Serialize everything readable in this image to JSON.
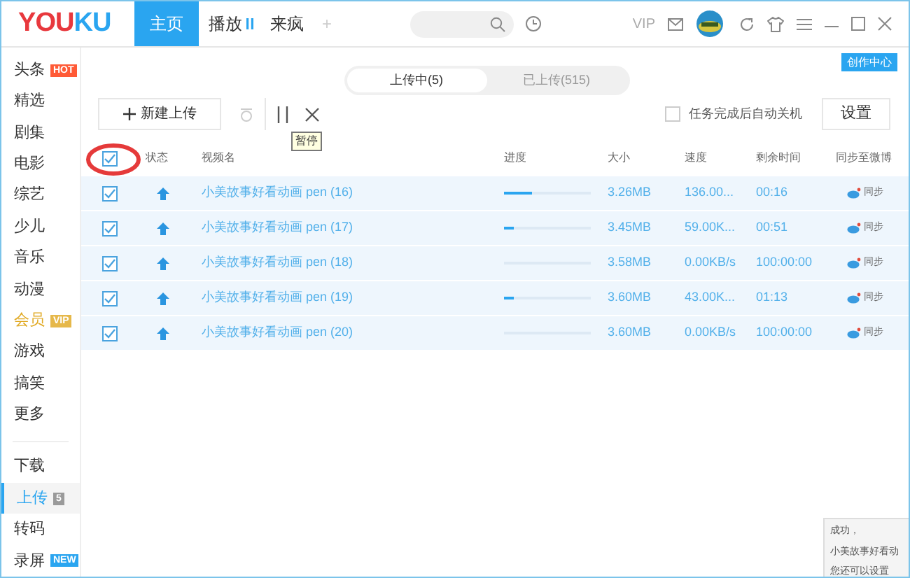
{
  "logo": {
    "left": "YOU",
    "right": "KU"
  },
  "nav_tabs": [
    {
      "label": "主页",
      "selected": true,
      "kind": "text"
    },
    {
      "label": "播放",
      "selected": false,
      "kind": "playing"
    },
    {
      "label": "来疯",
      "selected": false,
      "kind": "text"
    },
    {
      "label": "+",
      "selected": false,
      "kind": "add"
    }
  ],
  "top_right": {
    "vip": "VIP"
  },
  "sidebar": {
    "items": [
      {
        "label": "头条",
        "badge": {
          "text": "HOT",
          "color": "#ff5a36"
        },
        "selected": false
      },
      {
        "label": "精选",
        "selected": false
      },
      {
        "label": "剧集",
        "selected": false
      },
      {
        "label": "电影",
        "selected": false
      },
      {
        "label": "综艺",
        "selected": false
      },
      {
        "label": "少儿",
        "selected": false
      },
      {
        "label": "音乐",
        "selected": false
      },
      {
        "label": "动漫",
        "selected": false
      },
      {
        "label": "会员",
        "badge": {
          "text": "VIP",
          "color": "#e6b84a"
        },
        "selected": false,
        "gold": true
      },
      {
        "label": "游戏",
        "selected": false
      },
      {
        "label": "搞笑",
        "selected": false
      },
      {
        "label": "更多",
        "selected": false
      }
    ],
    "tools": [
      {
        "label": "下载",
        "selected": false
      },
      {
        "label": "上传",
        "badge": {
          "text": "5",
          "color": "#9a9a9a"
        },
        "selected": true
      },
      {
        "label": "转码",
        "selected": false
      },
      {
        "label": "录屏",
        "badge": {
          "text": "NEW",
          "color": "#2aa5f0"
        },
        "selected": false
      }
    ]
  },
  "create_center": "创作中心",
  "segments": [
    {
      "label": "上传中(5)",
      "selected": true
    },
    {
      "label": "已上传(515)",
      "selected": false
    }
  ],
  "toolbar": {
    "new_upload": "新建上传",
    "tooltip": "暂停",
    "shutdown": {
      "label": "任务完成后自动关机",
      "checked": false
    },
    "settings": "设置"
  },
  "table": {
    "all_checked": true,
    "columns": [
      "状态",
      "视频名",
      "进度",
      "大小",
      "速度",
      "剩余时间",
      "同步至微博"
    ],
    "rows": [
      {
        "checked": true,
        "name": "小美故事好看动画 pen (16)",
        "level": 0.32,
        "size": "3.26MB",
        "speed": "136.00...",
        "remaining": "00:16",
        "sync": "同步"
      },
      {
        "checked": true,
        "name": "小美故事好看动画 pen (17)",
        "level": 0.12,
        "size": "3.45MB",
        "speed": "59.00K...",
        "remaining": "00:51",
        "sync": "同步"
      },
      {
        "checked": true,
        "name": "小美故事好看动画 pen (18)",
        "level": 0,
        "size": "3.58MB",
        "speed": "0.00KB/s",
        "remaining": "100:00:00",
        "sync": "同步"
      },
      {
        "checked": true,
        "name": "小美故事好看动画 pen (19)",
        "level": 0.12,
        "size": "3.60MB",
        "speed": "43.00K...",
        "remaining": "01:13",
        "sync": "同步"
      },
      {
        "checked": true,
        "name": "小美故事好看动画 pen (20)",
        "level": 0,
        "size": "3.60MB",
        "speed": "0.00KB/s",
        "remaining": "100:00:00",
        "sync": "同步"
      }
    ]
  },
  "notification": {
    "line_1": "成功，",
    "line_2": "小美故事好看动",
    "line_3": "您还可以设置"
  }
}
